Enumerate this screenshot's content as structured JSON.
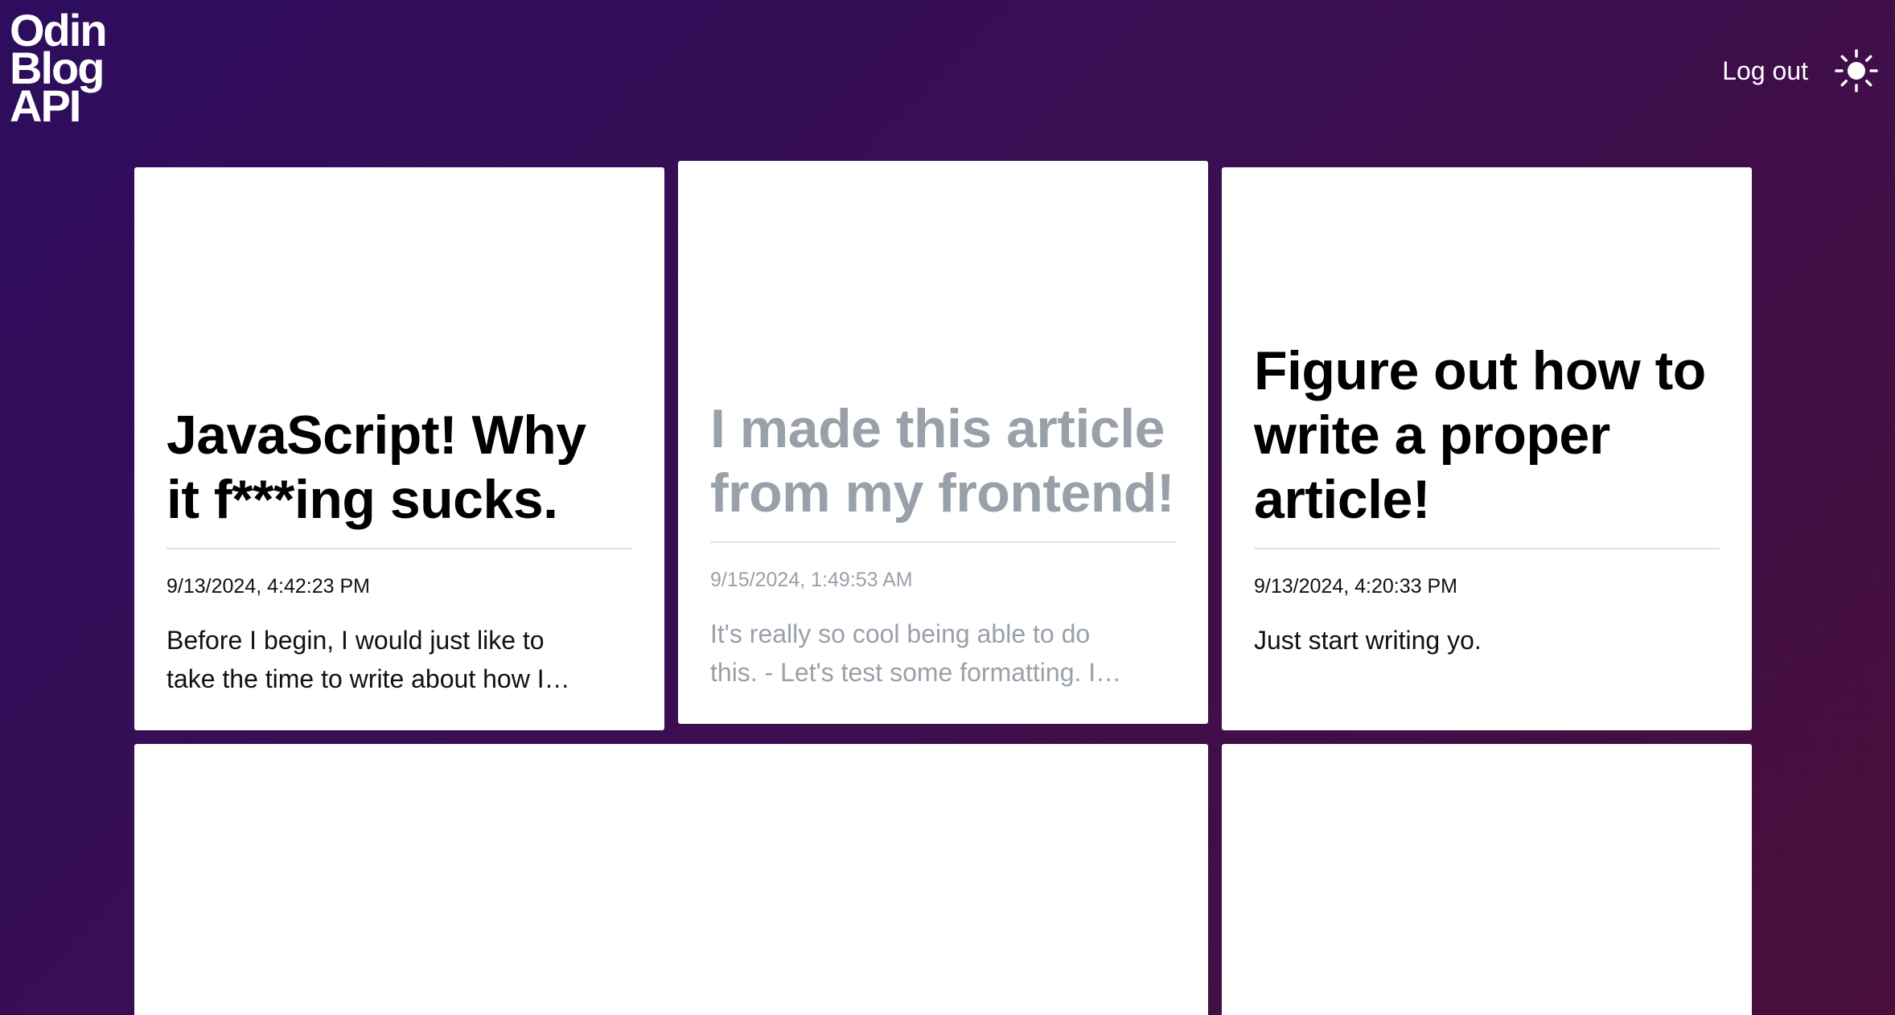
{
  "header": {
    "logo_line1": "Odin",
    "logo_line2": "Blog",
    "logo_line3": "API",
    "logout_label": "Log out",
    "theme_icon": "sun-icon"
  },
  "posts": [
    {
      "title": "JavaScript! Why it f***ing sucks.",
      "date": "9/13/2024, 4:42:23 PM",
      "excerpt": "Before I begin, I would just like to take the time to write about how I…",
      "status": "published"
    },
    {
      "title": "I made this article from my frontend!",
      "date": "9/15/2024, 1:49:53 AM",
      "excerpt": "It's really so cool being able to do this. - Let's test some formatting. I…",
      "status": "unpublished"
    },
    {
      "title": "Figure out how to write a proper article!",
      "date": "9/13/2024, 4:20:33 PM",
      "excerpt": "Just start writing yo.",
      "status": "published"
    }
  ],
  "colors": {
    "background_start": "#2e0d5e",
    "background_end": "#480f3a",
    "card": "#ffffff",
    "draft_text": "#9aa0aa"
  }
}
